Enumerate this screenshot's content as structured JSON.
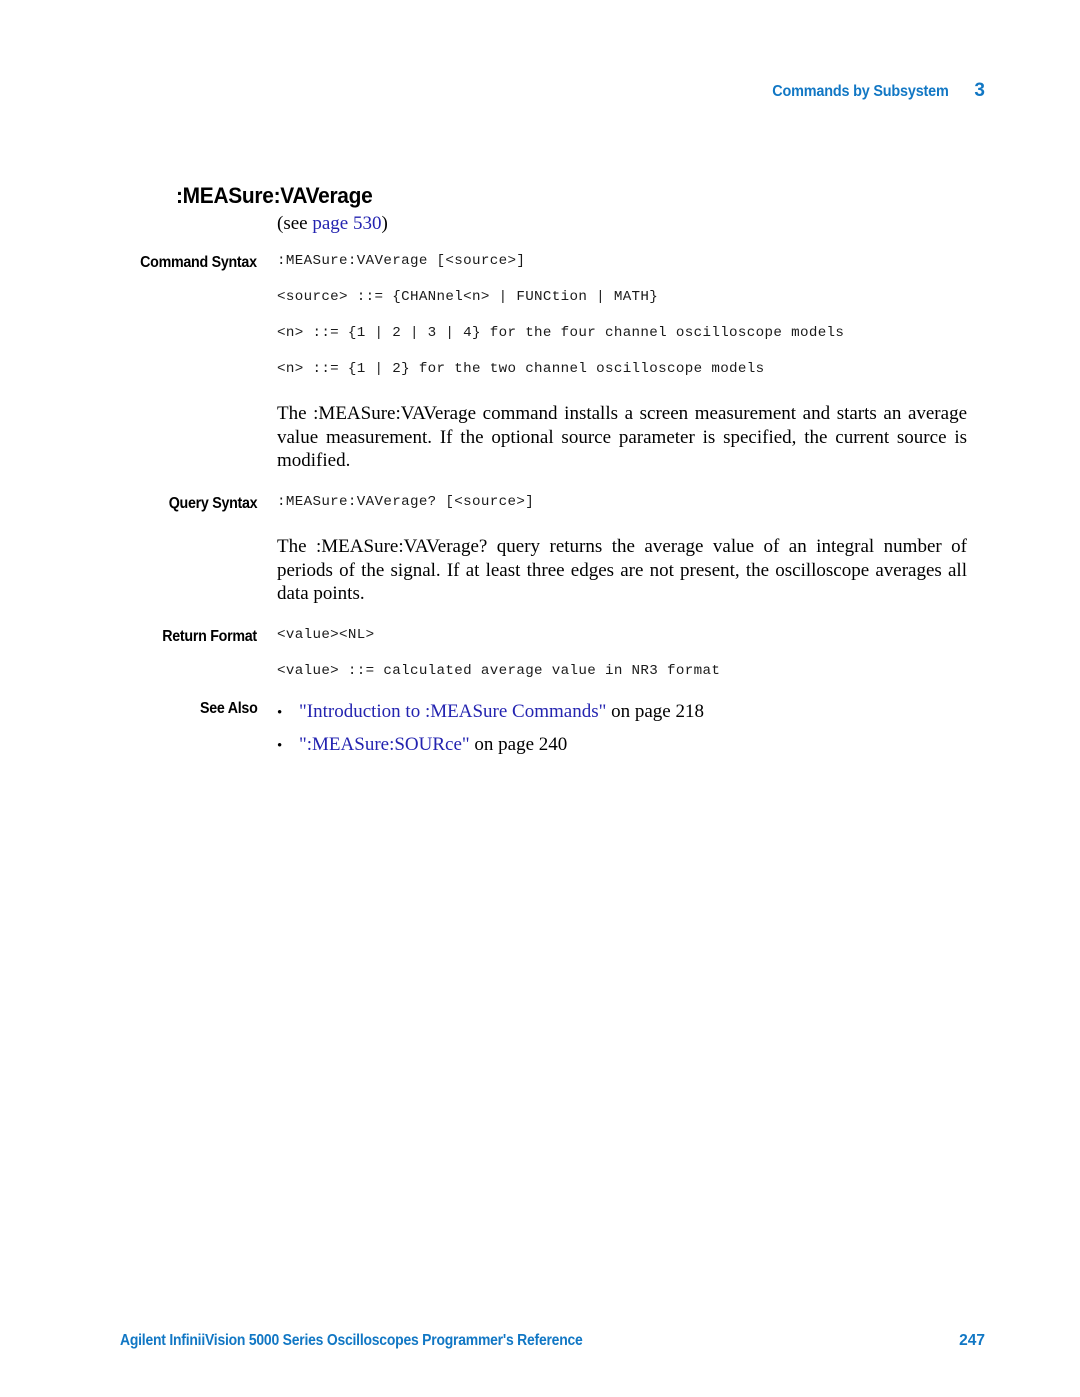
{
  "header": {
    "chapter_title": "Commands by Subsystem",
    "chapter_number": "3"
  },
  "command": {
    "title": ":MEASure:VAVerage",
    "see_prefix": "(see ",
    "see_link": "page 530",
    "see_suffix": ")"
  },
  "sections": {
    "command_syntax": {
      "label": "Command Syntax",
      "lines": [
        ":MEASure:VAVerage [<source>]",
        "<source> ::= {CHANnel<n> | FUNCtion | MATH}",
        "<n> ::= {1 | 2 | 3 | 4} for the four channel oscilloscope models",
        "<n> ::= {1 | 2} for the two channel oscilloscope models"
      ],
      "description": "The :MEASure:VAVerage command installs a screen measurement and starts an average value measurement. If the optional source parameter is specified, the current source is modified."
    },
    "query_syntax": {
      "label": "Query Syntax",
      "lines": [
        ":MEASure:VAVerage? [<source>]"
      ],
      "description": "The :MEASure:VAVerage? query returns the average value of an integral number of periods of the signal. If at least three edges are not present, the oscilloscope averages all data points."
    },
    "return_format": {
      "label": "Return Format",
      "lines": [
        "<value><NL>",
        "<value> ::= calculated average value in NR3 format"
      ]
    },
    "see_also": {
      "label": "See Also",
      "bullet": "•",
      "items": [
        {
          "link": "\"Introduction to :MEASure Commands\"",
          "tail": " on page 218"
        },
        {
          "link": "\":MEASure:SOURce\"",
          "tail": " on page 240"
        }
      ]
    }
  },
  "footer": {
    "text": "Agilent InfiniiVision 5000 Series Oscilloscopes Programmer's Reference",
    "page_number": "247"
  },
  "colors": {
    "brand_blue": "#1177c4",
    "link_blue": "#2323b0",
    "text_black": "#000000",
    "page_background": "#ffffff"
  }
}
